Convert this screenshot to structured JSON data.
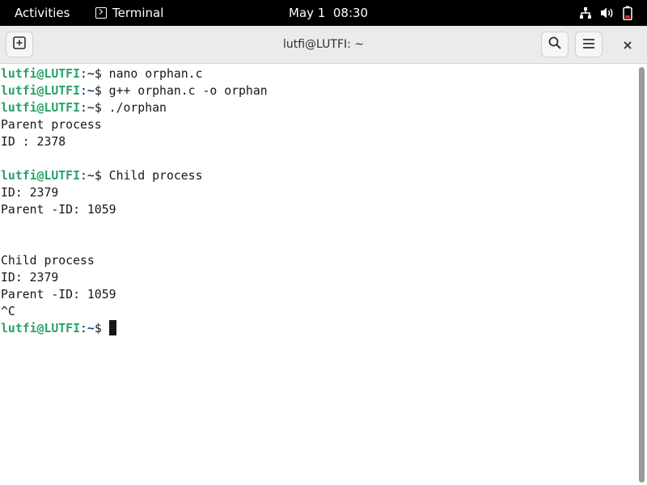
{
  "topbar": {
    "activities": "Activities",
    "app_name": "Terminal",
    "clock": "May 1  08:30"
  },
  "window": {
    "title": "lutfi@LUTFI: ~"
  },
  "terminal": {
    "lines": [
      {
        "type": "prompt",
        "user": "lutfi@LUTFI",
        "sep": ":",
        "path": "~",
        "sym": "$ ",
        "cmd": "nano orphan.c"
      },
      {
        "type": "prompt",
        "user": "lutfi@LUTFI",
        "sep": ":",
        "path": "~",
        "sym": "$ ",
        "cmd": "g++ orphan.c -o orphan"
      },
      {
        "type": "prompt",
        "user": "lutfi@LUTFI",
        "sep": ":",
        "path": "~",
        "sym": "$ ",
        "cmd": "./orphan"
      },
      {
        "type": "output",
        "text": "Parent process"
      },
      {
        "type": "output",
        "text": "ID : 2378"
      },
      {
        "type": "output",
        "text": ""
      },
      {
        "type": "prompt",
        "user": "lutfi@LUTFI",
        "sep": ":",
        "path": "~",
        "sym": "$ ",
        "cmd": "Child process"
      },
      {
        "type": "output",
        "text": "ID: 2379"
      },
      {
        "type": "output",
        "text": "Parent -ID: 1059"
      },
      {
        "type": "output",
        "text": ""
      },
      {
        "type": "output",
        "text": ""
      },
      {
        "type": "output",
        "text": "Child process"
      },
      {
        "type": "output",
        "text": "ID: 2379"
      },
      {
        "type": "output",
        "text": "Parent -ID: 1059"
      },
      {
        "type": "output",
        "text": "^C"
      },
      {
        "type": "prompt",
        "user": "lutfi@LUTFI",
        "sep": ":",
        "path": "~",
        "sym": "$ ",
        "cmd": "",
        "cursor": true
      }
    ]
  },
  "icons": {
    "app": "terminal-icon",
    "new_tab": "new-tab-icon",
    "search": "search-icon",
    "menu": "hamburger-menu-icon",
    "close": "close-icon",
    "network": "network-icon",
    "volume": "volume-icon",
    "battery": "battery-icon"
  },
  "colors": {
    "prompt_user": "#26a269",
    "prompt_path": "#12488b",
    "text": "#171717",
    "battery_low": "#e01b24"
  }
}
